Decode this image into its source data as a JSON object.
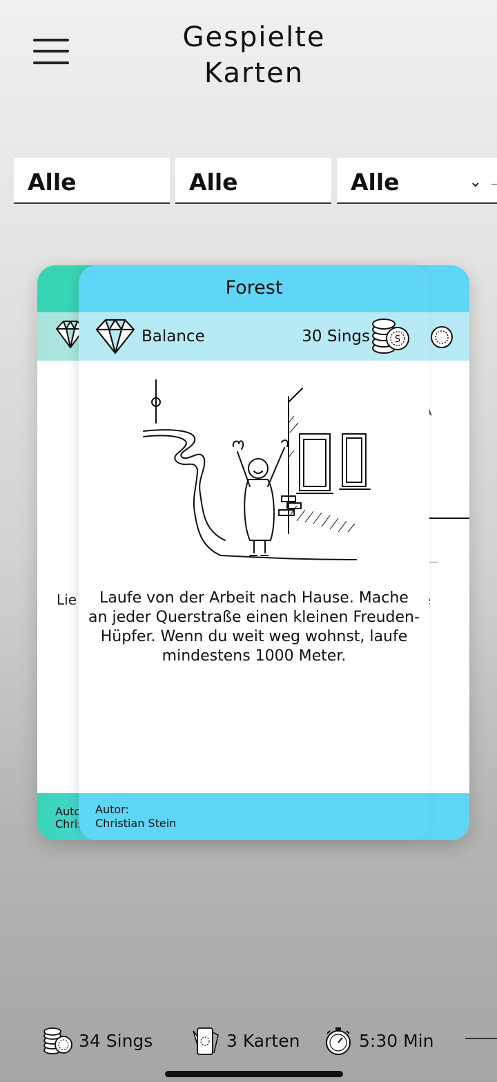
{
  "header": {
    "title_line1": "Gespielte",
    "title_line2": "Karten"
  },
  "filters": [
    {
      "value": "Alle"
    },
    {
      "value": "Alle"
    },
    {
      "value": "Alle"
    }
  ],
  "back_card": {
    "text_fragment_left": "Lie",
    "text_fragment_right": "e",
    "author_fragment_1": "Autc",
    "author_fragment_2": "Chris"
  },
  "card": {
    "title": "Forest",
    "category": "Balance",
    "sings": "30 Sings",
    "description": "Laufe von der Arbeit nach Hause. Mache an jeder Querstraße einen kleinen Freuden-Hüpfer. Wenn du weit weg wohnst, laufe mindestens 1000 Meter.",
    "author_label": "Autor:",
    "author_name": "Christian Stein",
    "colors": {
      "header": "#5fd6f5",
      "info": "#b8eaf6",
      "back_accent": "#38d5b4"
    }
  },
  "stats": {
    "sings": "34 Sings",
    "cards": "3 Karten",
    "time": "5:30 Min"
  },
  "icons": [
    "menu-icon",
    "chevron-down-icon",
    "diamond-icon",
    "coins-icon",
    "card-icon",
    "stopwatch-icon"
  ]
}
